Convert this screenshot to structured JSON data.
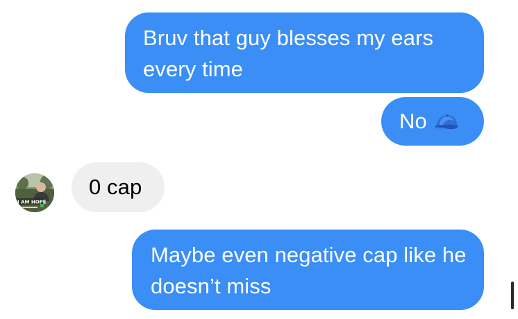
{
  "conversation": {
    "messages": [
      {
        "direction": "sent",
        "text": "Bruv that guy blesses my ears every time"
      },
      {
        "direction": "sent",
        "text": "No",
        "emoji": "blue-cap-icon"
      },
      {
        "direction": "received",
        "text": "0 cap"
      },
      {
        "direction": "sent",
        "text": "Maybe even negative cap like he doesn’t miss"
      }
    ],
    "avatar": {
      "badge_text": "I AM HOPE",
      "icon": "avatar-photo"
    }
  },
  "colors": {
    "sent_bubble": "#3a8ef6",
    "received_bubble": "#efefef",
    "background": "#ffffff"
  }
}
